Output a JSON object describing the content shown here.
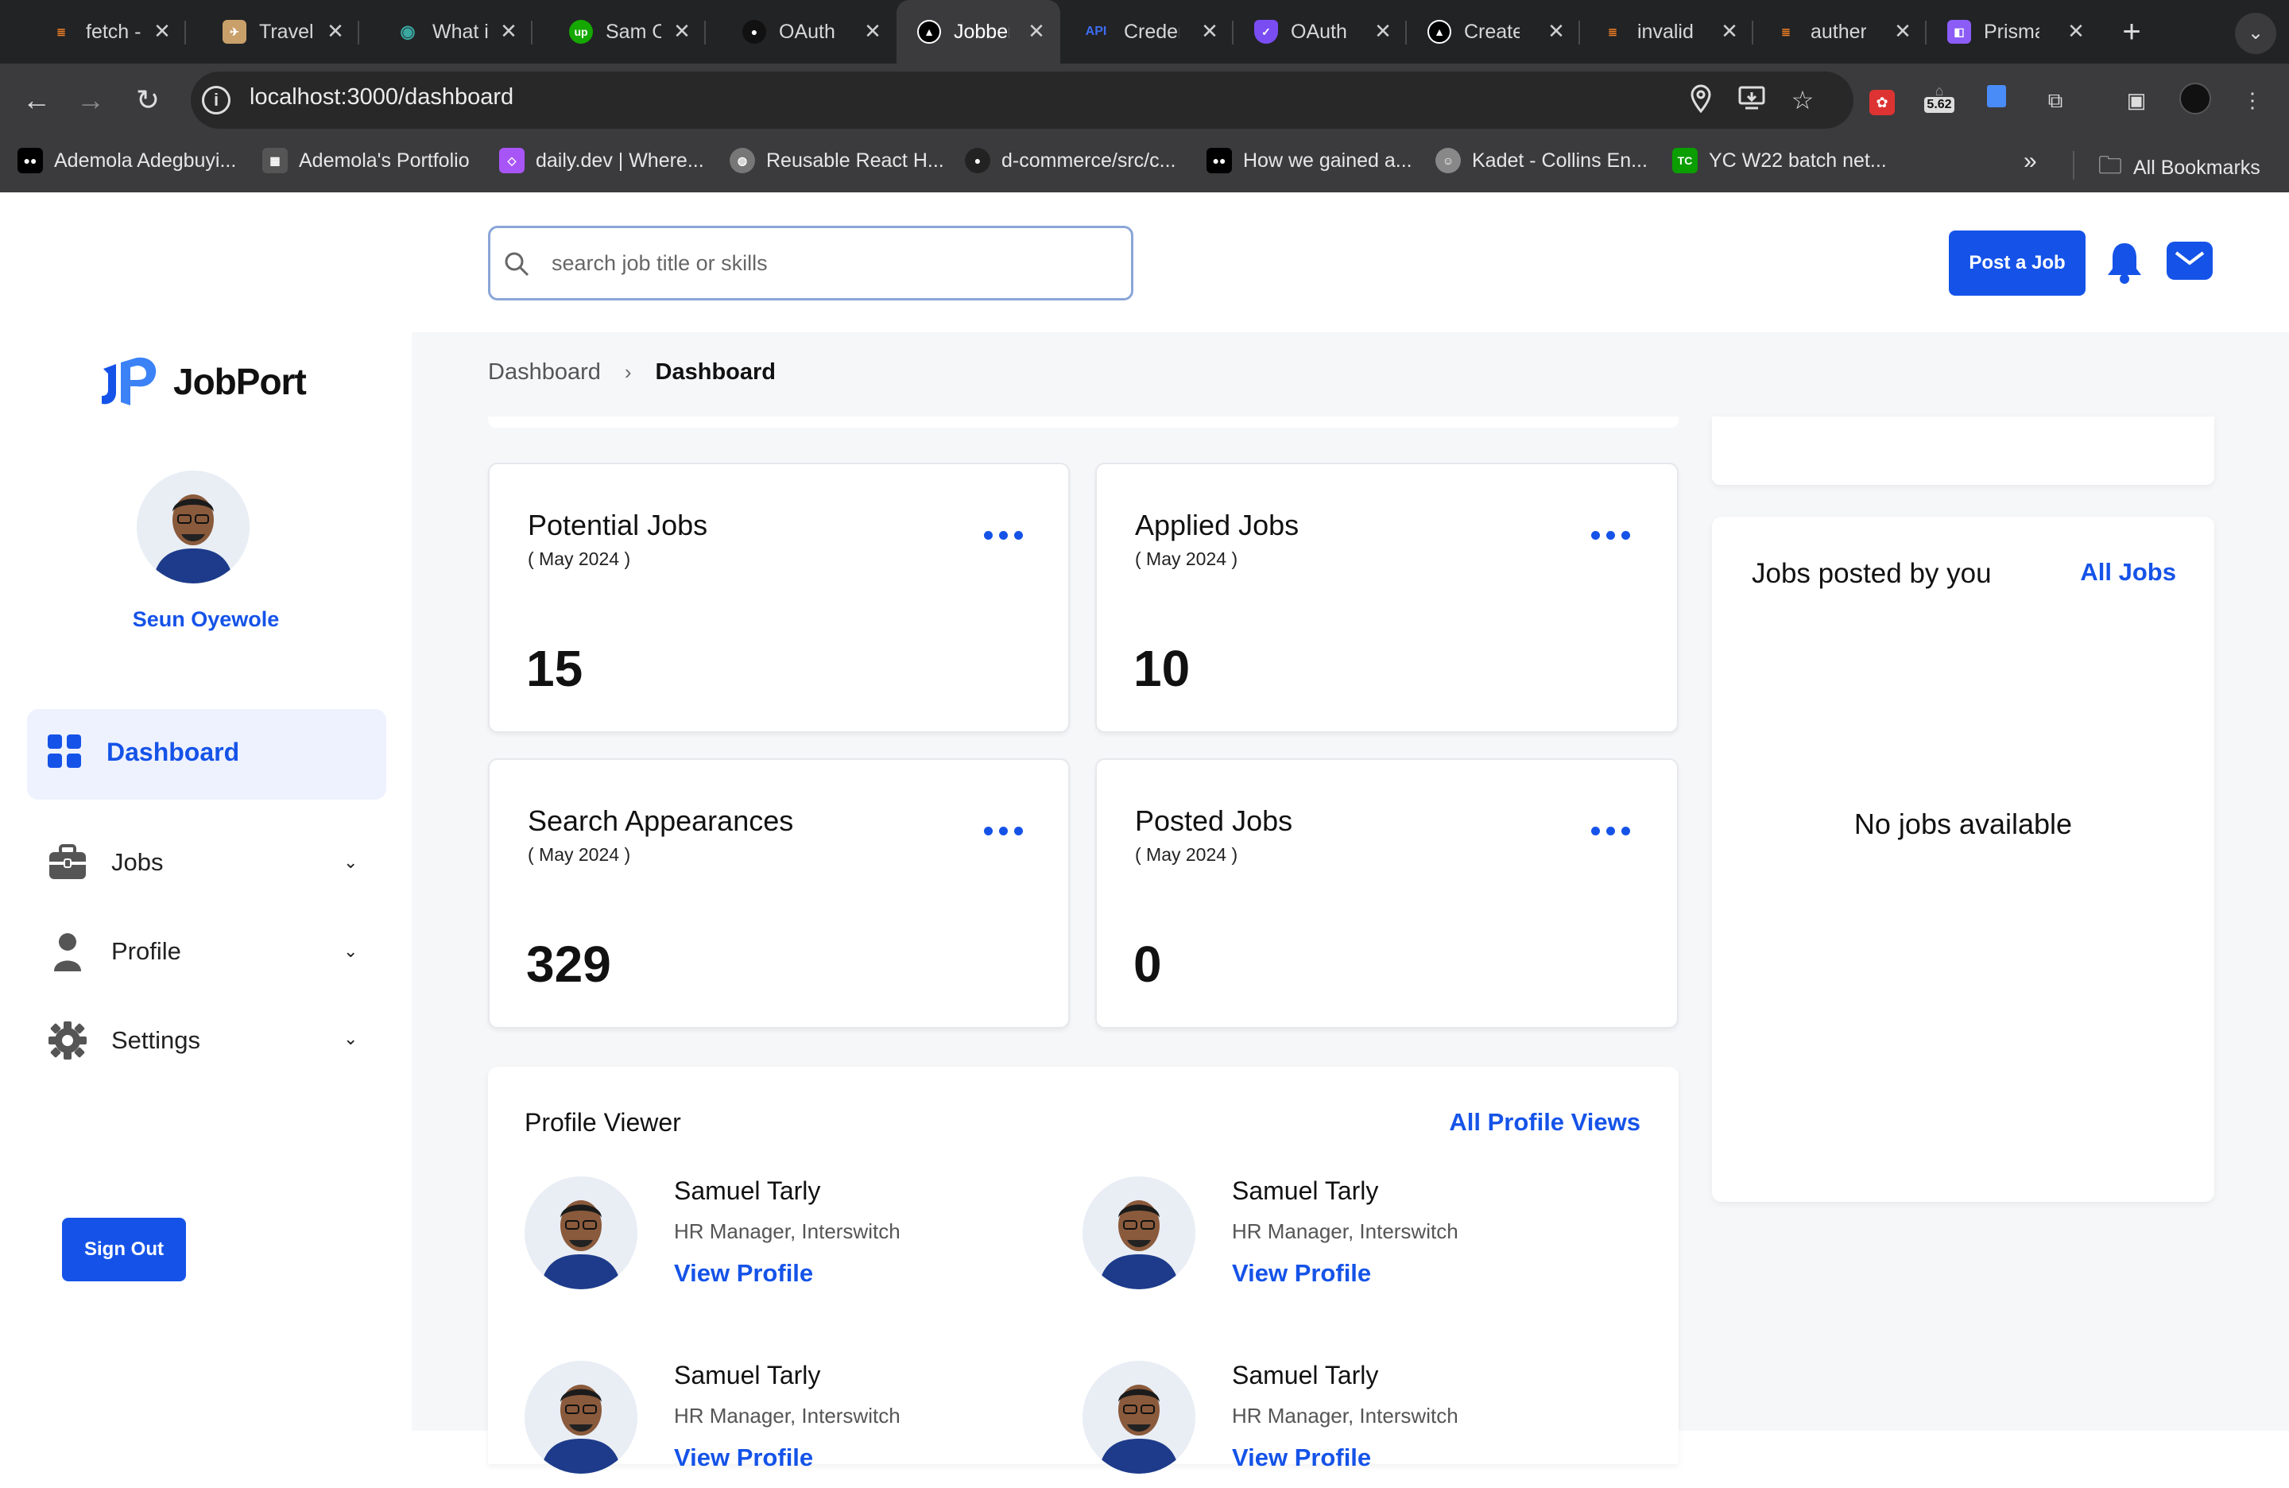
{
  "browser": {
    "tabs": [
      {
        "title": "fetch -",
        "favicon": "stackoverflow-icon",
        "color": "#f48024"
      },
      {
        "title": "Travel",
        "favicon": "travel-icon",
        "color": "#c9a06a"
      },
      {
        "title": "What i",
        "favicon": "eye-icon",
        "color": "#3aa7a0"
      },
      {
        "title": "Sam O",
        "favicon": "upwork-icon",
        "color": "#14a800"
      },
      {
        "title": "OAuth",
        "favicon": "github-icon",
        "color": "#333"
      },
      {
        "title": "Jobber",
        "favicon": "nextjs-icon",
        "color": "#000"
      },
      {
        "title": "Creder",
        "favicon": "api-icon",
        "color": "#3c6df0"
      },
      {
        "title": "OAuth",
        "favicon": "shield-icon",
        "color": "#7a4df3"
      },
      {
        "title": "Create",
        "favicon": "nextjs-icon",
        "color": "#000"
      },
      {
        "title": "invalid",
        "favicon": "stackoverflow-icon",
        "color": "#f48024"
      },
      {
        "title": "auther",
        "favicon": "stackoverflow-icon",
        "color": "#f48024"
      },
      {
        "title": "Prisma",
        "favicon": "prisma-icon",
        "color": "#8b5cf6"
      }
    ],
    "url": "localhost:3000/dashboard",
    "extension_badge": "5.62",
    "bookmarks": [
      {
        "label": "Ademola Adegbuyi...",
        "favicon": "medium-icon",
        "color": "#000"
      },
      {
        "label": "Ademola's Portfolio",
        "favicon": "portfolio-icon",
        "color": "#555"
      },
      {
        "label": "daily.dev | Where...",
        "favicon": "dailydev-icon",
        "color": "#a855f7"
      },
      {
        "label": "Reusable React H...",
        "favicon": "globe-icon",
        "color": "#777"
      },
      {
        "label": "d-commerce/src/c...",
        "favicon": "github-icon",
        "color": "#222"
      },
      {
        "label": "How we gained a...",
        "favicon": "medium-icon",
        "color": "#000"
      },
      {
        "label": "Kadet - Collins En...",
        "favicon": "avatar-icon",
        "color": "#888"
      },
      {
        "label": "YC W22 batch net...",
        "favicon": "techcrunch-icon",
        "color": "#0a9e01"
      }
    ],
    "all_bookmarks": "All Bookmarks"
  },
  "sidebar": {
    "logo": "JobPort",
    "user_name": "Seun Oyewole",
    "nav": [
      {
        "label": "Dashboard",
        "icon": "grid-icon",
        "active": true
      },
      {
        "label": "Jobs",
        "icon": "briefcase-icon"
      },
      {
        "label": "Profile",
        "icon": "person-icon"
      },
      {
        "label": "Settings",
        "icon": "gear-icon"
      }
    ],
    "sign_out": "Sign Out"
  },
  "header": {
    "search_placeholder": "search job title or skills",
    "post_job": "Post a Job"
  },
  "breadcrumb": [
    "Dashboard",
    "Dashboard"
  ],
  "stats": [
    {
      "title": "Potential Jobs",
      "date": "( May 2024 )",
      "value": "15"
    },
    {
      "title": "Applied Jobs",
      "date": "( May 2024 )",
      "value": "10"
    },
    {
      "title": "Search Appearances",
      "date": "( May 2024 )",
      "value": "329"
    },
    {
      "title": "Posted Jobs",
      "date": "( May 2024 )",
      "value": "0"
    }
  ],
  "jobs_panel": {
    "title": "Jobs posted by you",
    "link": "All Jobs",
    "empty": "No jobs available"
  },
  "profile_viewer": {
    "title": "Profile Viewer",
    "link": "All Profile Views",
    "viewers": [
      {
        "name": "Samuel Tarly",
        "role": "HR Manager, Interswitch",
        "action": "View Profile"
      },
      {
        "name": "Samuel Tarly",
        "role": "HR Manager, Interswitch",
        "action": "View Profile"
      },
      {
        "name": "Samuel Tarly",
        "role": "HR Manager, Interswitch",
        "action": "View Profile"
      },
      {
        "name": "Samuel Tarly",
        "role": "HR Manager, Interswitch",
        "action": "View Profile"
      }
    ]
  },
  "colors": {
    "accent": "#1553e8",
    "background": "#f6f7f9"
  }
}
